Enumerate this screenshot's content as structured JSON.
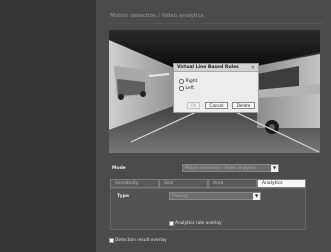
{
  "page": {
    "title": "Motion detection / Video analytics"
  },
  "dialog": {
    "title": "Virtual Line Based Rules",
    "close": "×",
    "options": [
      {
        "label": "Right"
      },
      {
        "label": "Left"
      }
    ],
    "buttons": {
      "ok": "OK",
      "cancel": "Cancel",
      "delete": "Delete"
    }
  },
  "mode": {
    "label": "Mode",
    "value": "Motion detection / Video analytics"
  },
  "tabs": [
    "Sensitivity",
    "Size",
    "Area",
    "Analytics"
  ],
  "analytics": {
    "type_label": "Type",
    "type_value": "Passing",
    "overlay_label": "Analytics rule overlay"
  },
  "detection_overlay_label": "Detection result overlay",
  "colors": {
    "background": "#4b4b4b",
    "sidebar": "#363636",
    "active_tab": "#f7f7f7",
    "dialog": "#ececec"
  },
  "icons": {
    "dropdown": "chevron-down-icon",
    "close": "close-icon"
  }
}
